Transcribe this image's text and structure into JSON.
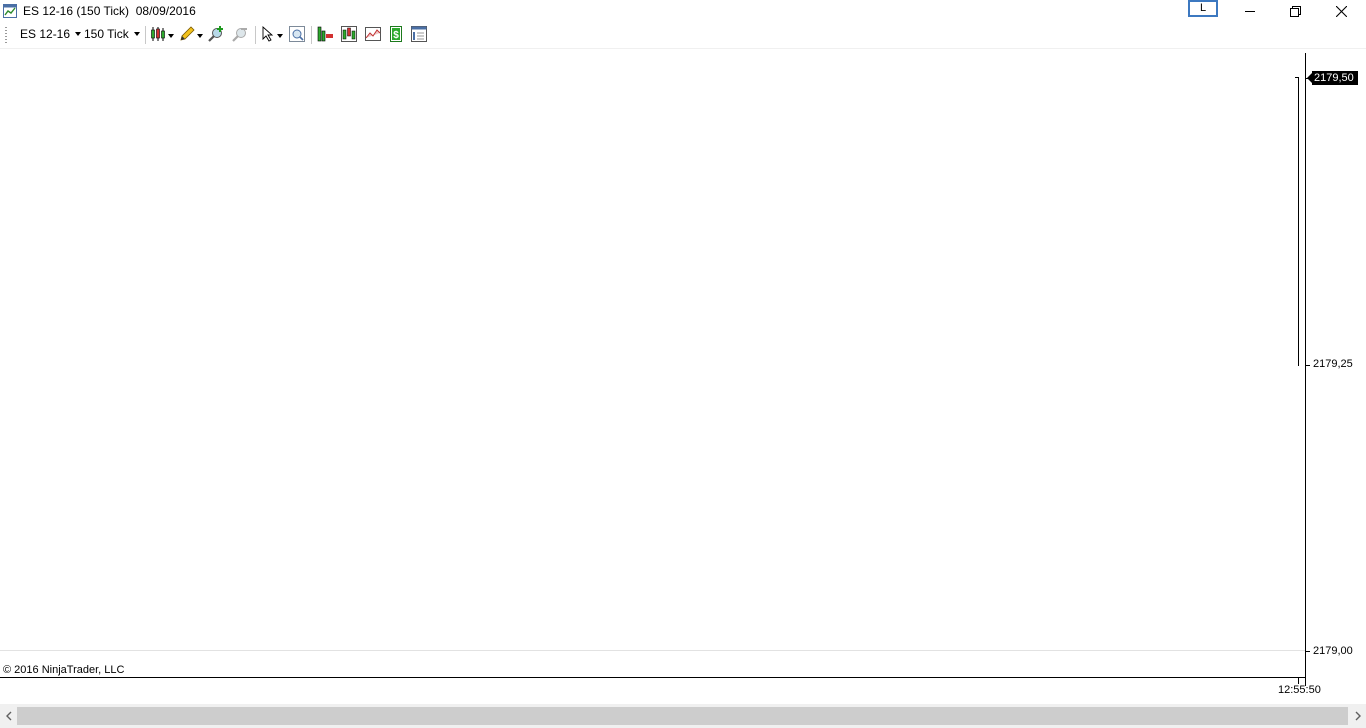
{
  "window": {
    "title": "ES 12-16 (150 Tick)  08/09/2016",
    "link_button_label": "L"
  },
  "toolbar": {
    "instrument": "ES 12-16",
    "interval": "150 Tick"
  },
  "chart": {
    "price_axis": [
      "2179,50",
      "2179,25",
      "2179,00"
    ],
    "current_price": "2179,50",
    "time_axis": [
      "12:55:50"
    ],
    "copyright": "© 2016 NinjaTrader, LLC"
  },
  "colors": {
    "accent": "#3c78c0",
    "background": "#ffffff",
    "scrollbar_track": "#f0f0f0",
    "scrollbar_thumb": "#cdcdcd"
  },
  "icons": {
    "titlebar": [
      "chart-app-icon",
      "minimize-icon",
      "restore-icon",
      "close-icon"
    ],
    "toolbar": [
      "bar-type-icon",
      "drawing-tools-icon",
      "zoom-in-icon",
      "zoom-out-icon",
      "pointer-icon",
      "data-box-icon",
      "add-indicator-icon",
      "add-strategy-icon",
      "chart-style-icon",
      "trade-icon",
      "properties-icon"
    ]
  }
}
